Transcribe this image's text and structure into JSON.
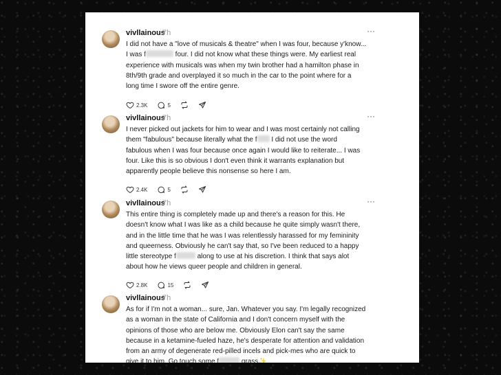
{
  "posts": [
    {
      "username": "vivllainous",
      "time": "7h",
      "text_a": "I did not have a \"love of musicals & theatre\" when I was four, because y'know...\nI was f",
      "text_b": " four. I did not know what these things were. My earliest real\nexperience with musicals was when my twin brother had a hamilton phase in\n8th/9th grade and overplayed it so much in the car to the point where for a\nlong time I swore off the entire genre.",
      "likes": "2.3K",
      "replies": "5"
    },
    {
      "username": "vivllainous",
      "time": "7h",
      "text_a": "I never picked out jackets for him to wear and I was most certainly not calling\nthem \"fabulous\" because literally what the f",
      "text_b": " I did not use the word\nfabulous when I was four because once again I would like to reiterate... I was\nfour. Like this is so obvious I don't even think it warrants explanation but\napparently people believe this nonsense so here I am.",
      "likes": "2.4K",
      "replies": "5"
    },
    {
      "username": "vivllainous",
      "time": "7h",
      "text_a": "This entire thing is completely made up and there's a reason for this. He\ndoesn't know what I was like as a child because he quite simply wasn't there,\nand in the little time that he was I was relentlessly harassed for my femininity\nand queerness. Obviously he can't say that, so I've been reduced to a happy\nlittle stereotype f",
      "text_b": " along to use at his discretion. I think that says alot\nabout how he views queer people and children in general.",
      "likes": "2.8K",
      "replies": "15"
    },
    {
      "username": "vivllainous",
      "time": "7h",
      "text_a": "As for if I'm not a woman... sure, Jan. Whatever you say. I'm legally recognized\nas a woman in the state of California and I don't concern myself with the\nopinions of those who are below me. Obviously Elon can't say the same\nbecause in a ketamine-fueled haze, he's desperate for attention and validation\nfrom an army of degenerate red-pilled incels and pick-mes who are quick to\ngive it to him. Go touch some f",
      "text_b": " grass",
      "sparkle": "✨"
    }
  ],
  "icons": [
    "heart-icon",
    "comment-icon",
    "repost-icon",
    "share-icon",
    "more-icon"
  ],
  "more_glyph": "···"
}
